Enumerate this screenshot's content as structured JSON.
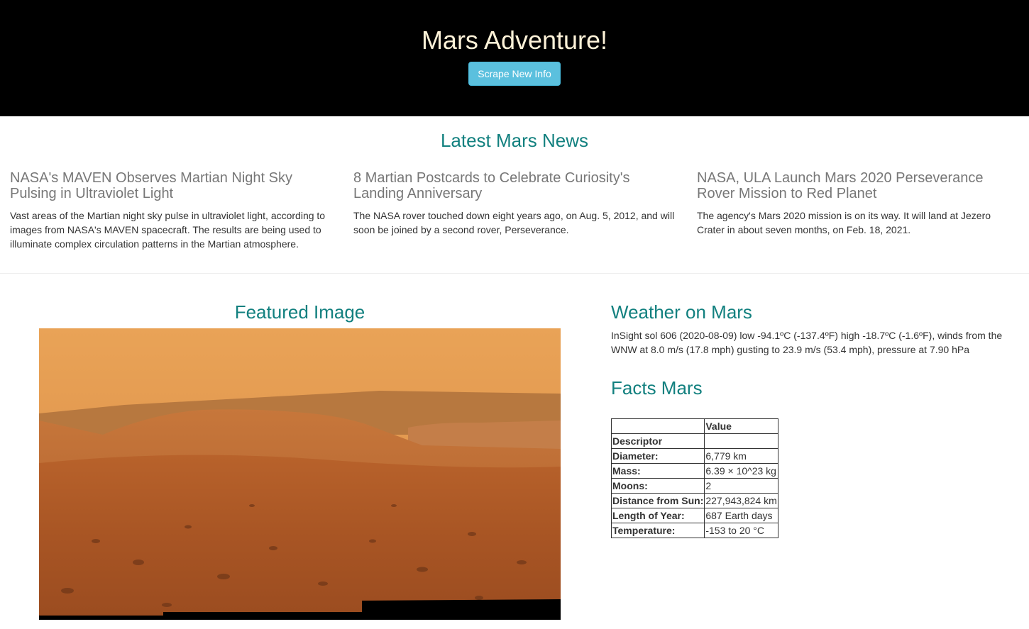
{
  "header": {
    "title": "Mars Adventure!",
    "scrape_button": "Scrape New Info",
    "background": "#000000",
    "button_color": "#5bc0de"
  },
  "news": {
    "heading": "Latest Mars News",
    "items": [
      {
        "title": "NASA's MAVEN Observes Martian Night Sky Pulsing in Ultraviolet Light",
        "paragraph": "Vast areas of the Martian night sky pulse in ultraviolet light, according to images from NASA's MAVEN spacecraft. The results are being used to illuminate complex circulation patterns in the Martian atmosphere."
      },
      {
        "title": "8 Martian Postcards to Celebrate Curiosity's Landing Anniversary",
        "paragraph": "The NASA rover touched down eight years ago, on Aug. 5, 2012, and will soon be joined by a second rover, Perseverance."
      },
      {
        "title": "NASA, ULA Launch Mars 2020 Perseverance Rover Mission to Red Planet",
        "paragraph": "The agency's Mars 2020 mission is on its way. It will land at Jezero Crater in about seven months, on Feb. 18, 2021."
      }
    ]
  },
  "featured": {
    "heading": "Featured Image",
    "image_subject": "martian-landscape-panorama"
  },
  "weather": {
    "heading": "Weather on Mars",
    "text": "InSight sol 606 (2020-08-09) low -94.1ºC (-137.4ºF) high -18.7ºC (-1.6ºF), winds from the WNW at 8.0 m/s (17.8 mph) gusting to 23.9 m/s (53.4 mph), pressure at 7.90 hPa"
  },
  "facts": {
    "heading": "Facts Mars",
    "header_cols": [
      "",
      "Value"
    ],
    "index_label": "Descriptor",
    "rows": [
      {
        "label": "Diameter:",
        "value": "6,779 km"
      },
      {
        "label": "Mass:",
        "value": "6.39 × 10^23 kg"
      },
      {
        "label": "Moons:",
        "value": "2"
      },
      {
        "label": "Distance from Sun:",
        "value": "227,943,824 km"
      },
      {
        "label": "Length of Year:",
        "value": "687 Earth days"
      },
      {
        "label": "Temperature:",
        "value": "-153 to 20 °C"
      }
    ]
  },
  "colors": {
    "accent": "#12807f",
    "news_title": "#777777"
  }
}
